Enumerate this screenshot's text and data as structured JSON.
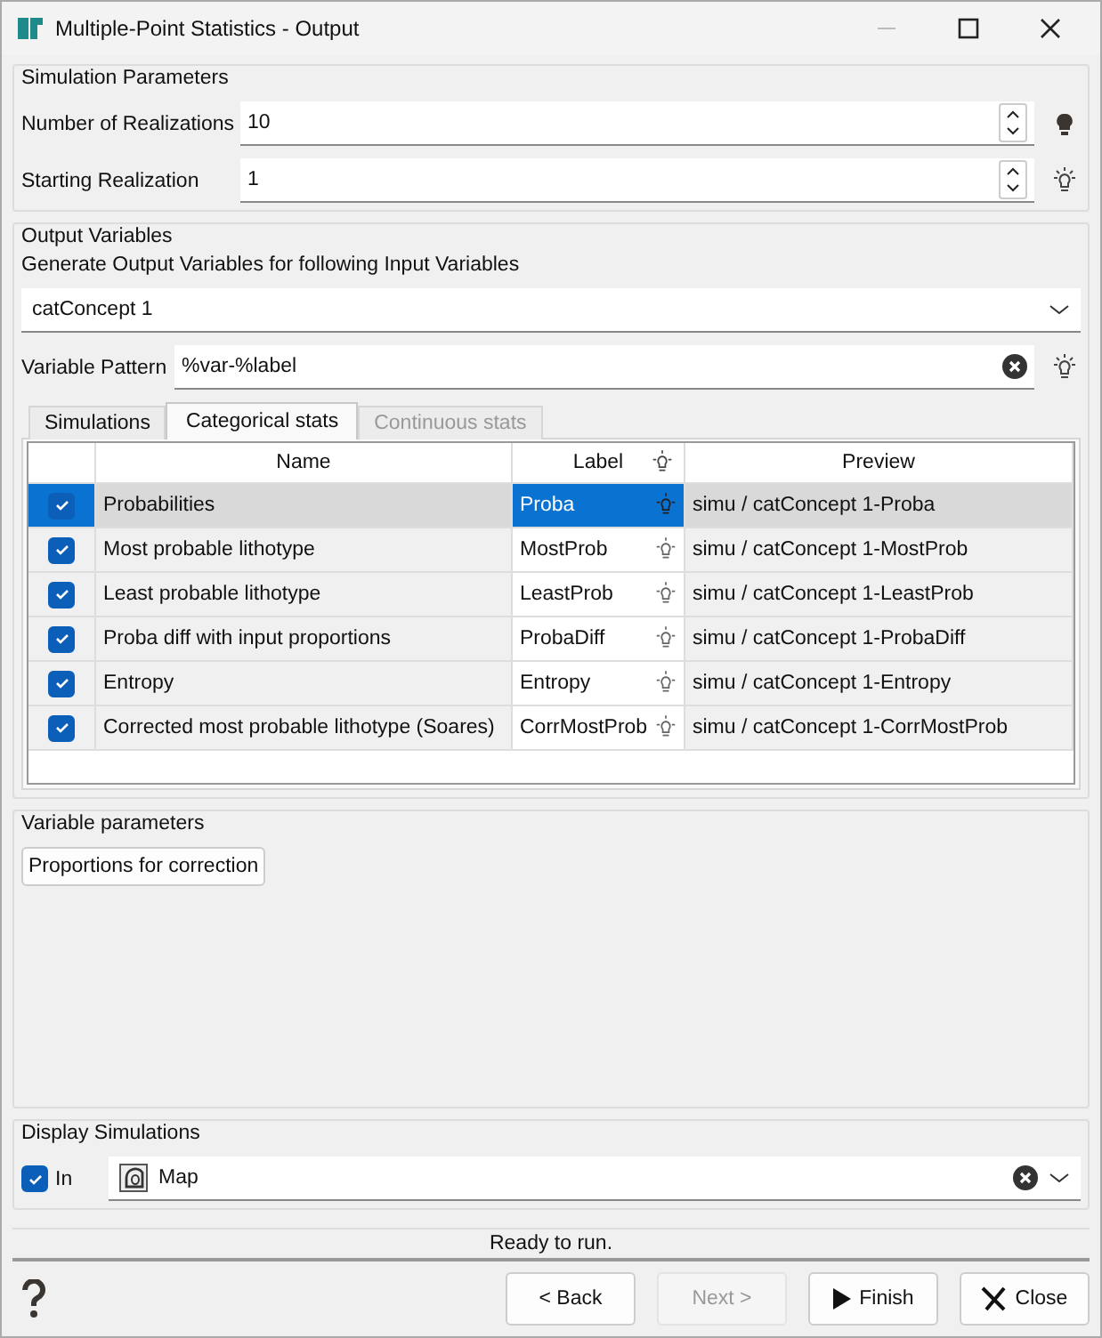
{
  "window": {
    "title": "Multiple-Point Statistics - Output"
  },
  "simulation_parameters": {
    "title": "Simulation Parameters",
    "fields": [
      {
        "label": "Number of Realizations",
        "value": "10",
        "lit": true
      },
      {
        "label": "Starting Realization",
        "value": "1",
        "lit": false
      }
    ]
  },
  "output_variables": {
    "title": "Output Variables",
    "description": "Generate Output Variables for following Input Variables",
    "input_variable": "catConcept 1",
    "pattern_label": "Variable Pattern",
    "pattern_value": "%var-%label",
    "tabs": [
      {
        "label": "Simulations",
        "selected": false,
        "disabled": false
      },
      {
        "label": "Categorical stats",
        "selected": true,
        "disabled": false
      },
      {
        "label": "Continuous stats",
        "selected": false,
        "disabled": true
      }
    ],
    "table": {
      "columns": [
        "Name",
        "Label",
        "Preview"
      ],
      "rows": [
        {
          "checked": true,
          "selected": true,
          "name": "Probabilities",
          "label": "Proba",
          "preview": "simu / catConcept 1-Proba"
        },
        {
          "checked": true,
          "selected": false,
          "name": "Most probable lithotype",
          "label": "MostProb",
          "preview": "simu / catConcept 1-MostProb"
        },
        {
          "checked": true,
          "selected": false,
          "name": "Least probable lithotype",
          "label": "LeastProb",
          "preview": "simu / catConcept 1-LeastProb"
        },
        {
          "checked": true,
          "selected": false,
          "name": "Proba diff with input proportions",
          "label": "ProbaDiff",
          "preview": "simu / catConcept 1-ProbaDiff"
        },
        {
          "checked": true,
          "selected": false,
          "name": "Entropy",
          "label": "Entropy",
          "preview": "simu / catConcept 1-Entropy"
        },
        {
          "checked": true,
          "selected": false,
          "name": "Corrected most probable lithotype (Soares)",
          "label": "CorrMostProb",
          "preview": "simu / catConcept 1-CorrMostProb"
        }
      ]
    }
  },
  "variable_parameters": {
    "title": "Variable parameters",
    "button": "Proportions for correction"
  },
  "display_simulations": {
    "title": "Display Simulations",
    "checkbox_label": "In",
    "checked": true,
    "view": "Map"
  },
  "status": "Ready to run.",
  "buttons": [
    {
      "kind": "back",
      "label": "< Back",
      "disabled": false
    },
    {
      "kind": "next",
      "label": "Next >",
      "disabled": true
    },
    {
      "kind": "finish",
      "label": "Finish",
      "disabled": false
    },
    {
      "kind": "close",
      "label": "Close",
      "disabled": false
    }
  ]
}
